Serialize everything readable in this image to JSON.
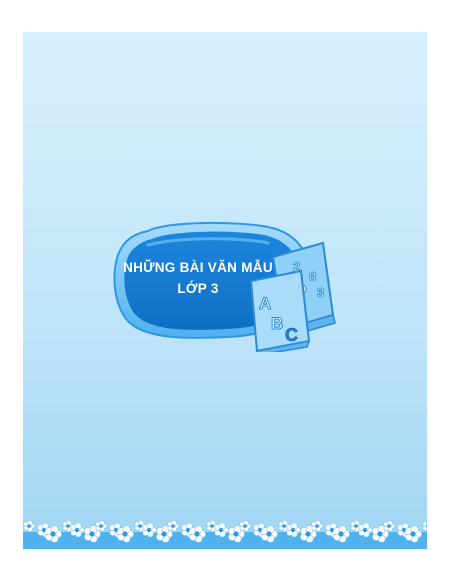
{
  "cover": {
    "title_line1": "NHỮNG BÀI VĂN MẪU",
    "title_line2": "LỚP 3"
  },
  "book_letters": [
    "A",
    "B",
    "C",
    "2",
    "8",
    "3"
  ],
  "colors": {
    "background_top": "#d6efff",
    "background_bottom": "#9fd6f3",
    "badge_blue": "#1d8fe0",
    "badge_rim": "#7cc8f5",
    "text": "#ffffff"
  }
}
